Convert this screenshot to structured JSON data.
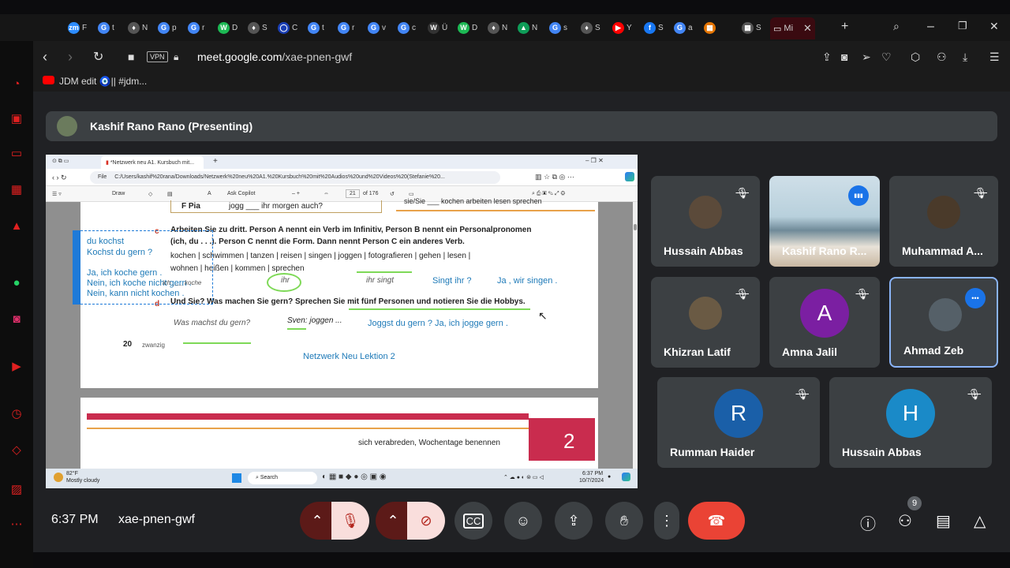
{
  "browser": {
    "tabs": [
      {
        "icon": "zm",
        "label": "F",
        "color": "#2d8cff"
      },
      {
        "icon": "G",
        "label": "t",
        "color": "#4285f4"
      },
      {
        "icon": "♦",
        "label": "N",
        "color": "#555"
      },
      {
        "icon": "G",
        "label": "p",
        "color": "#4285f4"
      },
      {
        "icon": "G",
        "label": "r",
        "color": "#4285f4"
      },
      {
        "icon": "W",
        "label": "D",
        "color": "#1db954"
      },
      {
        "icon": "♦",
        "label": "S",
        "color": "#555"
      },
      {
        "icon": "◯",
        "label": "C",
        "color": "#1a3fb4"
      },
      {
        "icon": "G",
        "label": "t",
        "color": "#4285f4"
      },
      {
        "icon": "G",
        "label": "r",
        "color": "#4285f4"
      },
      {
        "icon": "G",
        "label": "v",
        "color": "#4285f4"
      },
      {
        "icon": "G",
        "label": "c",
        "color": "#4285f4"
      },
      {
        "icon": "W",
        "label": "Ü",
        "color": "#333"
      },
      {
        "icon": "W",
        "label": "D",
        "color": "#1db954"
      },
      {
        "icon": "♦",
        "label": "N",
        "color": "#555"
      },
      {
        "icon": "▲",
        "label": "N",
        "color": "#0f9d58"
      },
      {
        "icon": "G",
        "label": "s",
        "color": "#4285f4"
      },
      {
        "icon": "♦",
        "label": "S",
        "color": "#555"
      },
      {
        "icon": "▶",
        "label": "Y",
        "color": "#ff0000"
      },
      {
        "icon": "f",
        "label": "S",
        "color": "#1877f2"
      },
      {
        "icon": "G",
        "label": "a",
        "color": "#4285f4"
      },
      {
        "icon": "▦",
        "label": "",
        "color": "#e37400"
      },
      {
        "icon": "▦",
        "label": "S",
        "color": "#555"
      }
    ],
    "active_tab_label": "Mi",
    "url_host": "meet.google.com",
    "url_path": "/xae-pnen-gwf",
    "vpn_label": "VPN",
    "bookmark": "JDM edit 🧿|| #jdm..."
  },
  "meet": {
    "presenter_text": "Kashif Rano Rano (Presenting)",
    "clock": "6:37 PM",
    "meeting_code": "xae-pnen-gwf",
    "people_count": "9",
    "participants": [
      {
        "name": "Hussain Abbas",
        "avatar": "",
        "color": "#5b4a3a",
        "muted": true
      },
      {
        "name": "Kashif Rano R...",
        "avatar": "",
        "color": "#8fb6c8",
        "muted": false
      },
      {
        "name": "Muhammad A...",
        "avatar": "",
        "color": "#4a3a2a",
        "muted": true
      },
      {
        "name": "Khizran Latif",
        "avatar": "",
        "color": "#6a5a44",
        "muted": true
      },
      {
        "name": "Amna Jalil",
        "avatar": "A",
        "color": "#7b1fa2",
        "muted": true
      },
      {
        "name": "Ahmad Zeb",
        "avatar": "",
        "color": "#556068",
        "muted": false
      },
      {
        "name": "Rumman Haider",
        "avatar": "R",
        "color": "#1a5fa8",
        "muted": true
      },
      {
        "name": "Hussain Abbas",
        "avatar": "H",
        "color": "#1a8ac8",
        "muted": true
      }
    ]
  },
  "screen": {
    "tab_title": "*Netzwerk neu A1. Kursbuch mit...",
    "file_label": "File",
    "file_path": "C:/Users/kashif%20rana/Downloads/Netzwerk%20neu%20A1.%20Kursbuch%20mit%20Audios%20und%20Videos%20(Stefanie%20...",
    "draw_label": "Draw",
    "copilot_label": "Ask Copilot",
    "page_num": "21",
    "page_total": "of 176",
    "doc": {
      "top_cut_a": "F  Pia",
      "top_cut_b": "jogg ___ ihr morgen auch?",
      "top_cut_c": "sie/Sie ___ kochen  arbeiten  lesen  sprechen",
      "c_letter": "c",
      "c_line1": "Arbeiten Sie zu dritt. Person A nennt ein Verb im Infinitiv, Person B nennt ein Personalpronomen",
      "c_line2": "(ich, du . . .). Person C nennt die Form. Dann nennt Person C ein anderes Verb.",
      "verbs1": "kochen  |  schwimmen  |  tanzen  |  reisen  |  singen  |  joggen  |  fotografieren  |  gehen  |  lesen  |",
      "verbs2": "wohnen  |  heißen  |  kommen  |  sprechen",
      "bubble1": "ihr",
      "bubble2": "ihr singt",
      "ans_c1": "Singt  ihr  ?",
      "ans_c2": "Ja , wir  singen .",
      "d_letter": "d",
      "d_line": "Und Sie? Was machen Sie gern? Sprechen Sie mit fünf Personen und notieren Sie die Hobbys.",
      "bubble3": "Was machst du gern?",
      "bubble4": "Sven: joggen ...",
      "ans_d": "Joggst  du  gern  ?   Ja,  ich  jogge  gern .",
      "page_no": "20",
      "page_word": "zwanzig",
      "footer_note": "Netzwerk Neu   Lektion 2",
      "side1": "du  kochst",
      "side2": "Kochst  du gern ?",
      "side3": "Ja, ich koche gern .",
      "side4": "Nein,  ich koche  nicht  gern .",
      "side5": "Nein, kann nicht  kochen .",
      "side_gray": "ich ___ koche",
      "page2_text": "sich verabreden, Wochentage benennen",
      "page2_num": "2"
    },
    "weather_temp": "82°F",
    "weather_desc": "Mostly cloudy",
    "search_label": "Search",
    "tb_time": "6:37 PM",
    "tb_date": "10/7/2024"
  },
  "colors": {
    "accent_red": "#e02020",
    "meet_bg": "#202124",
    "tile_bg": "#3c4043",
    "hangup": "#ea4335",
    "handwriting": "#1e7ab8",
    "highlight_green": "#7ed957"
  }
}
